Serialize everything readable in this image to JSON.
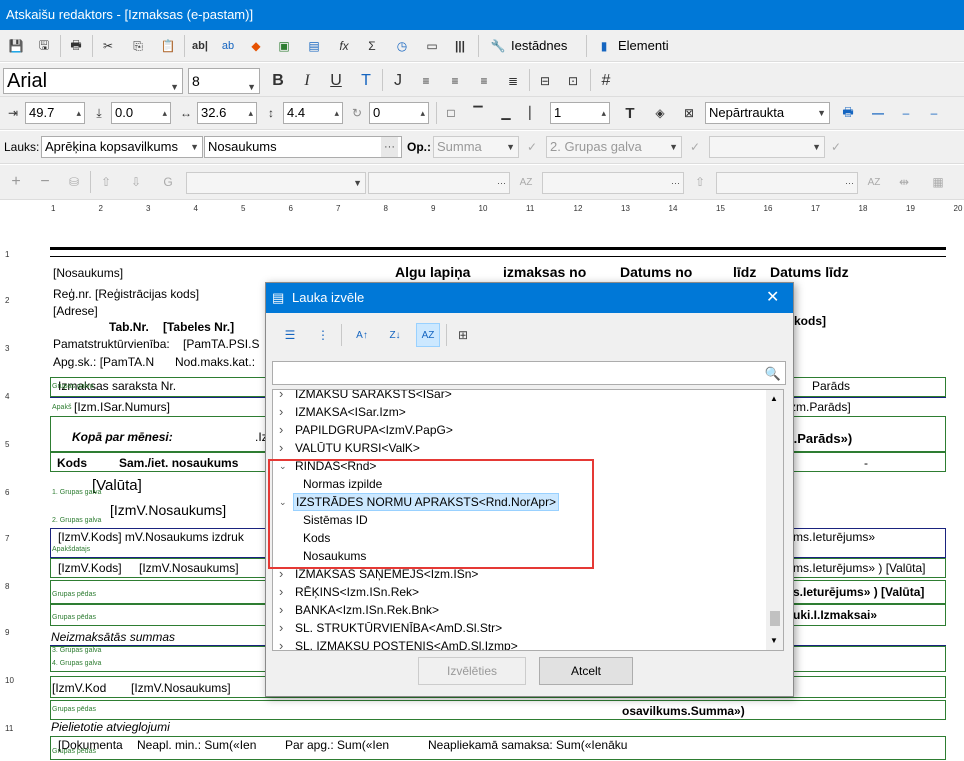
{
  "window": {
    "title": "Atskaišu redaktors - [Izmaksas (e-pastam)]"
  },
  "toolbar1": {
    "settings_label": "Iestādnes",
    "elements_label": "Elementi"
  },
  "format_bar": {
    "font": "Arial",
    "size": "8"
  },
  "position_bar": {
    "left": "49.7",
    "top": "0.0",
    "width": "32.6",
    "height": "4.4",
    "rotation": "0",
    "count": "1",
    "border_style": "Nepārtraukta"
  },
  "field_bar": {
    "label": "Lauks:",
    "field_source": "Aprēķina kopsavilkums",
    "field_name": "Nosaukums",
    "op_label": "Op.:",
    "op_value": "Summa",
    "group_value": "2. Grupas galva"
  },
  "ruler": [
    "1",
    "2",
    "3",
    "4",
    "5",
    "6",
    "7",
    "8",
    "9",
    "10",
    "11",
    "12",
    "13",
    "14",
    "15",
    "16",
    "17",
    "18",
    "19",
    "20"
  ],
  "row_numbers": [
    "1",
    "2",
    "3",
    "4",
    "5",
    "6",
    "7",
    "8",
    "9",
    "10",
    "11"
  ],
  "report": {
    "name": "[Nosaukums]",
    "regnr": "Reģ.nr. [Reģistrācijas kods]",
    "adrese": "[Adrese]",
    "tabnr_label": "Tab.Nr.",
    "tabnr_value": "[Tabeles Nr.]",
    "pamat": "Pamatstruktūrvienība:",
    "pamat_val": "[PamTA.PSI.S",
    "apg": "Apg.sk.: [PamTA.N",
    "nodmaks": "Nod.maks.kat.:",
    "h_algu": "Algu lapiņa",
    "h_izmaksas": "izmaksas no",
    "h_datums": "Datums no",
    "h_lidz": "līdz",
    "h_datumslidz": "Datums līdz",
    "h_kods": "kods]",
    "izm_nr": "Izmaksas saraksta Nr.",
    "parads": "Parāds",
    "izm_isar": "[Izm.ISar.Numurs]",
    "izm_parads": "zm.Parāds]",
    "kopa": "Kopā par mēnesi:",
    "kopa_i": ".Iz",
    "parads2": "l.Parāds»)",
    "kods": "Kods",
    "samiet": "Sam./iet. nosaukums",
    "dash": "-",
    "valuta": "[Valūta]",
    "nosauk": "[IzmV.Nosaukums]",
    "kods_row": "[IzmV.Kods] mV.Nosaukums izdruk",
    "ieturejums1": "ms.Ieturējums»",
    "kods2": "[IzmV.Kods]",
    "nosauk2": "[IzmV.Nosaukums]",
    "ieturejums2": "ms.Ieturējums» ) [Valūta]",
    "ieturejums3": "s.Ieturējums» ) [Valūta]",
    "izmaksai": "uki.I.Izmaksai»",
    "neizmaks": "Neizmaksātās summas",
    "kods3": "[IzmV.Kod",
    "nosauk3": "[IzmV.Nosaukums]",
    "summa": "osavilkums.Summa»)",
    "pieliet": "Pielietotie atvieglojumi",
    "dok": "[Dokumenta",
    "neapl": "Neapl. min.: Sum(«Ien",
    "parapg": "Par apg.: Sum(«Ien",
    "neaplsam": "Neapliekamā samaksa: Sum(«Ienāku",
    "band_labels": [
      "Grupas galva",
      "Apakš",
      "1. Grupas galva",
      "2. Grupas galva",
      "Apakšdatajs",
      "Grupas pēdas",
      "Grupas pēdas",
      "3. Grupas galva",
      "4. Grupas galva",
      "Grupas pēdas",
      "Grupas pēdas"
    ]
  },
  "dialog": {
    "title": "Lauka izvēle",
    "search_placeholder": "",
    "tree": [
      "IZMAKSU SARAKSTS<ISar>",
      "IZMAKSA<ISar.Izm>",
      "PAPILDGRUPA<IzmV.PapG>",
      "VALŪTU KURSI<ValK>",
      "RINDAS<Rnd>",
      "Normas izpilde",
      "IZSTRĀDES NORMU APRAKSTS<Rnd.NorApr>",
      "Sistēmas ID",
      "Kods",
      "Nosaukums",
      "IZMAKSAS SAŅĒMĒJS<Izm.ISn>",
      "RĒĶINS<Izm.ISn.Rek>",
      "BANKA<Izm.ISn.Rek.Bnk>",
      "SL. STRUKTŪRVIENĪBA<AmD.Sl.Str>",
      "SL. IZMAKSU POSTENIS<AmD.Sl.Izmp>"
    ],
    "select_label": "Izvēlēties",
    "cancel_label": "Atcelt",
    "highlight_color": "#cce8ff",
    "annotation_color": "#e53935"
  }
}
